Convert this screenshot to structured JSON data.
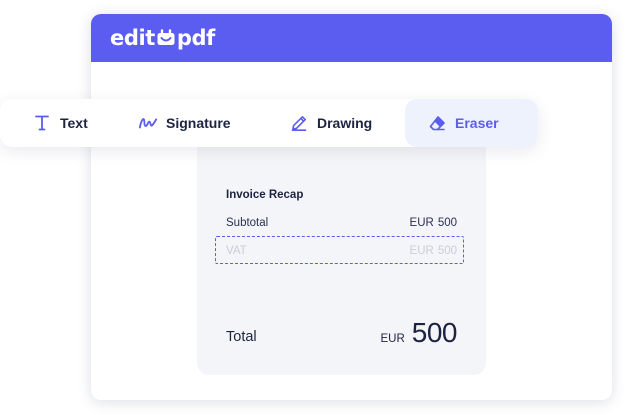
{
  "app": {
    "logo_left": "edit",
    "logo_right": "pdf",
    "logo_icon": "smile-icon",
    "accent_color": "#5b5cf0"
  },
  "toolbar": {
    "tools": [
      {
        "label": "Text",
        "icon": "text-cursor-icon",
        "active": false
      },
      {
        "label": "Signature",
        "icon": "signature-icon",
        "active": false
      },
      {
        "label": "Drawing",
        "icon": "pencil-icon",
        "active": false
      },
      {
        "label": "Eraser",
        "icon": "eraser-icon",
        "active": true
      }
    ]
  },
  "invoice": {
    "title": "Invoice Recap",
    "subtotal": {
      "label": "Subtotal",
      "currency": "EUR",
      "value": "500"
    },
    "vat": {
      "label": "VAT",
      "currency": "EUR",
      "value": "500",
      "state": "selected-for-erase"
    },
    "total": {
      "label": "Total",
      "currency": "EUR",
      "value": "500"
    }
  }
}
